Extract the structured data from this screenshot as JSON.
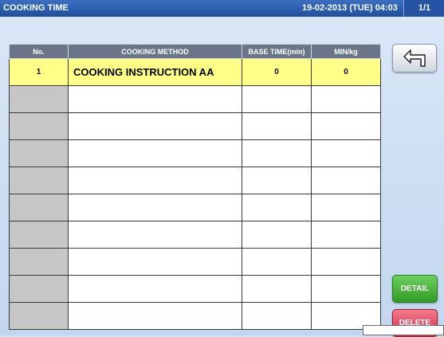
{
  "title": "COOKING TIME",
  "datetime": "19-02-2013 (TUE) 04:03",
  "page": "1/1",
  "table": {
    "headers": [
      "No.",
      "COOKING METHOD",
      "BASE TIME(min)",
      "MIN/kg"
    ],
    "rows": [
      {
        "no": "1",
        "method": "COOKING INSTRUCTION AA",
        "base_time": "0",
        "min_per_kg": "0"
      },
      {
        "no": "",
        "method": "",
        "base_time": "",
        "min_per_kg": ""
      },
      {
        "no": "",
        "method": "",
        "base_time": "",
        "min_per_kg": ""
      },
      {
        "no": "",
        "method": "",
        "base_time": "",
        "min_per_kg": ""
      },
      {
        "no": "",
        "method": "",
        "base_time": "",
        "min_per_kg": ""
      },
      {
        "no": "",
        "method": "",
        "base_time": "",
        "min_per_kg": ""
      },
      {
        "no": "",
        "method": "",
        "base_time": "",
        "min_per_kg": ""
      },
      {
        "no": "",
        "method": "",
        "base_time": "",
        "min_per_kg": ""
      },
      {
        "no": "",
        "method": "",
        "base_time": "",
        "min_per_kg": ""
      },
      {
        "no": "",
        "method": "",
        "base_time": "",
        "min_per_kg": ""
      }
    ]
  },
  "buttons": {
    "back_icon": "return-arrow-icon",
    "detail": "DETAIL",
    "delete": "DELETE"
  },
  "colors": {
    "title_bar": "#1f4f9e",
    "header_bg": "#6a7688",
    "selected_row": "#ffff88",
    "detail_button": "#3aa82f",
    "delete_button": "#e23a55"
  }
}
